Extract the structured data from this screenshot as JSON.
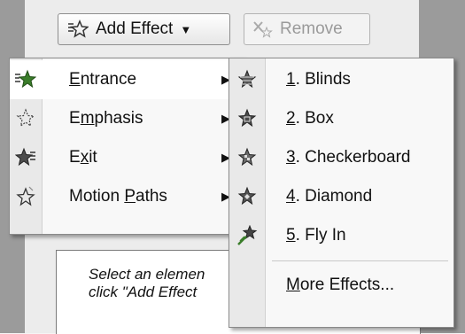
{
  "toolbar": {
    "add_effect": {
      "pre": "",
      "u": "",
      "post": "Add Effect"
    },
    "remove": "Remove"
  },
  "main_menu": [
    {
      "pre": "",
      "u": "E",
      "post": "ntrance",
      "icon": "entrance-star-icon"
    },
    {
      "pre": "E",
      "u": "m",
      "post": "phasis",
      "icon": "emphasis-star-icon"
    },
    {
      "pre": "E",
      "u": "x",
      "post": "it",
      "icon": "exit-star-icon"
    },
    {
      "pre": "Motion ",
      "u": "P",
      "post": "aths",
      "icon": "motion-paths-star-icon"
    }
  ],
  "entrance_menu": [
    {
      "num": "1",
      "post": ". Blinds",
      "icon": "blinds-star-icon"
    },
    {
      "num": "2",
      "post": ". Box",
      "icon": "box-star-icon"
    },
    {
      "num": "3",
      "post": ". Checkerboard",
      "icon": "checkerboard-star-icon"
    },
    {
      "num": "4",
      "post": ". Diamond",
      "icon": "diamond-star-icon"
    },
    {
      "num": "5",
      "post": ". Fly In",
      "icon": "fly-in-star-icon"
    },
    {
      "pre": "",
      "u": "M",
      "post": "ore Effects..."
    }
  ],
  "hint": {
    "line1": "Select an elemen",
    "line2": "click \"Add Effect"
  },
  "colors": {
    "star_green": "#3a7d2a",
    "star_gray": "#4d4d4d"
  }
}
